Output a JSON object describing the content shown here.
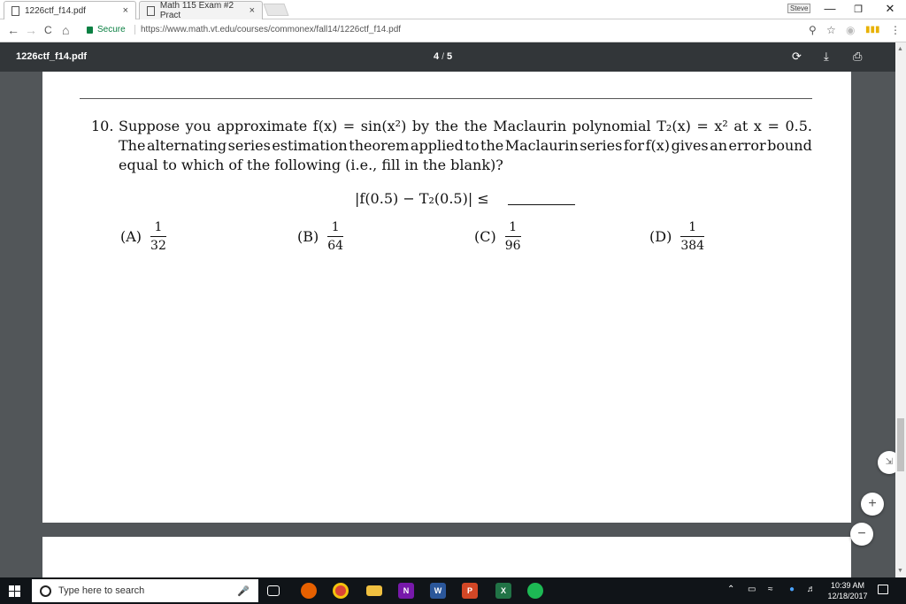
{
  "browser": {
    "tabs": [
      {
        "label": "1226ctf_f14.pdf",
        "close": "×"
      },
      {
        "label": "Math 115 Exam #2 Pract",
        "close": "×"
      }
    ],
    "user_badge": "Steve",
    "window_controls": {
      "minimize": "—",
      "maximize": "❐",
      "close": "✕"
    },
    "nav": {
      "back": "←",
      "forward": "→",
      "reload": "C",
      "home": "⌂"
    },
    "secure_label": "Secure",
    "url": "https://www.math.vt.edu/courses/commonex/fall14/1226ctf_f14.pdf",
    "icons": [
      "zoom-icon",
      "star-icon",
      "extension-icon",
      "extension-bars-icon",
      "menu-icon"
    ]
  },
  "pdf_toolbar": {
    "title": "1226ctf_f14.pdf",
    "current_page": "4",
    "separator": "/",
    "total_pages": "5",
    "icons": [
      "rotate-icon",
      "download-icon",
      "print-icon"
    ]
  },
  "question": {
    "number": "10.",
    "line1": [
      "Suppose",
      "you",
      "approximate",
      "f(x)",
      "=",
      "sin(x²)",
      "by",
      "the",
      "the",
      "Maclaurin",
      "polynomial",
      "T₂(x)",
      "=",
      "x²",
      "at",
      "x",
      "=",
      "0.5."
    ],
    "line2": [
      "The",
      "alternating",
      "series",
      "estimation",
      "theorem",
      "applied",
      "to",
      "the",
      "Maclaurin",
      "series",
      "for",
      "f(x)",
      "gives",
      "an",
      "error",
      "bound"
    ],
    "line3": "equal to which of the following (i.e., fill in the blank)?",
    "inequality": "|f(0.5) − T₂(0.5)| ≤",
    "choices": [
      {
        "label": "(A)",
        "num": "1",
        "den": "32"
      },
      {
        "label": "(B)",
        "num": "1",
        "den": "64"
      },
      {
        "label": "(C)",
        "num": "1",
        "den": "96"
      },
      {
        "label": "(D)",
        "num": "1",
        "den": "384"
      }
    ]
  },
  "viewer_controls": {
    "fit": "⇲",
    "zoom_in": "+",
    "zoom_out": "−"
  },
  "taskbar": {
    "search_placeholder": "Type here to search",
    "apps": [
      "task-view-icon",
      "firefox-icon",
      "chrome-icon",
      "file-explorer-icon",
      "onenote-icon",
      "word-icon",
      "powerpoint-icon",
      "excel-icon",
      "spotify-icon"
    ],
    "app_letters": {
      "onenote": "N",
      "word": "W",
      "powerpoint": "P",
      "excel": "X"
    },
    "time": "10:39 AM",
    "date": "12/18/2017"
  },
  "colors": {
    "pdf_toolbar": "#323639",
    "viewer_bg": "#525659",
    "secure_green": "#0b8043",
    "taskbar": "#101418"
  }
}
